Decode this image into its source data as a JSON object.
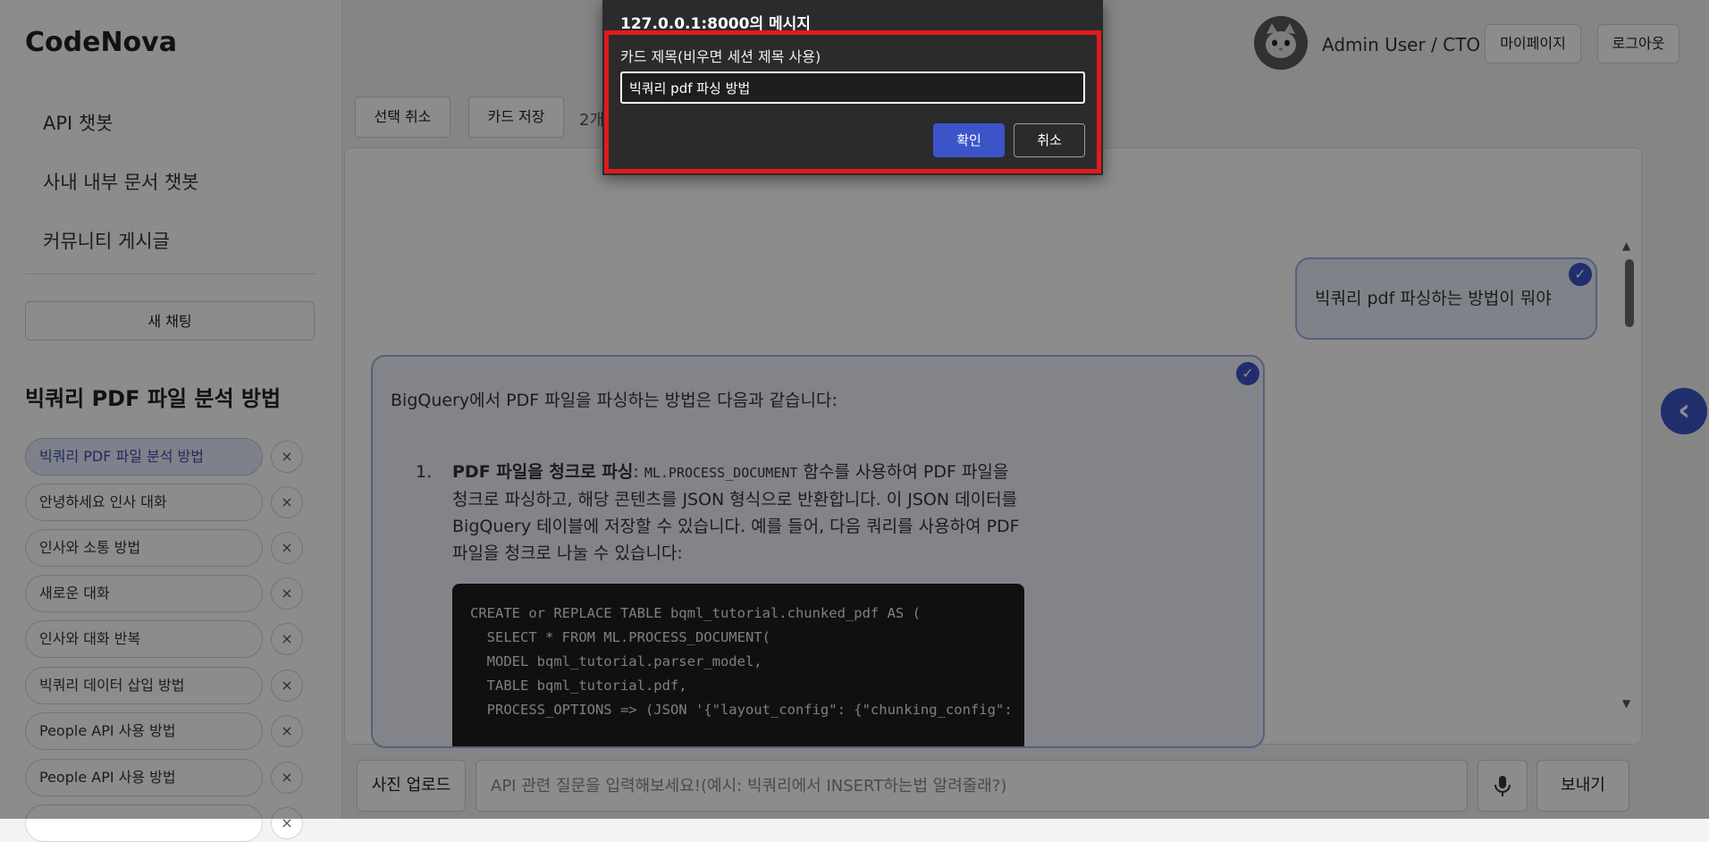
{
  "sidebar": {
    "logo": "CodeNova",
    "nav": [
      "API 챗봇",
      "사내 내부 문서 챗봇",
      "커뮤니티 게시글"
    ],
    "new_chat": "새 채팅",
    "session_title": "빅쿼리 PDF 파일 분석 방법",
    "sessions": [
      "빅쿼리 PDF 파일 분석 방법",
      "안녕하세요 인사 대화",
      "인사와 소통 방법",
      "새로운 대화",
      "인사와 대화 반복",
      "빅쿼리 데이터 삽입 방법",
      "People API 사용 방법",
      "People API 사용 방법"
    ],
    "delete_glyph": "×"
  },
  "header": {
    "user": "Admin User / CTO",
    "mypage": "마이페이지",
    "logout": "로그아웃"
  },
  "toolbar": {
    "deselect": "선택 취소",
    "save_card": "카드 저장",
    "selected_count": "2개"
  },
  "chat": {
    "user_message": "빅쿼리 pdf 파싱하는 방법이 뭐야",
    "bot_intro": "BigQuery에서 PDF 파일을 파싱하는 방법은 다음과 같습니다:",
    "list_num": "1.",
    "item_title": "PDF 파일을 청크로 파싱",
    "item_func": "ML.PROCESS_DOCUMENT",
    "item_body_1": ": ",
    "item_body_2": " 함수를 사용하여 PDF 파일을 청크로 파싱하고, 해당 콘텐츠를 JSON 형식으로 반환합니다. 이 JSON 데이터를 BigQuery 테이블에 저장할 수 있습니다. 예를 들어, 다음 쿼리를 사용하여 PDF 파일을 청크로 나눌 수 있습니다:",
    "code": "CREATE or REPLACE TABLE bqml_tutorial.chunked_pdf AS (\n  SELECT * FROM ML.PROCESS_DOCUMENT(\n  MODEL bqml_tutorial.parser_model,\n  TABLE bqml_tutorial.pdf,\n  PROCESS_OPTIONS => (JSON '{\"layout_config\": {\"chunking_config\":",
    "check_glyph": "✓"
  },
  "bottom": {
    "upload": "사진 업로드",
    "placeholder": "API 관련 질문을 입력해보세요!(예시: 빅쿼리에서 INSERT하는법 알려줄래?)",
    "mic_icon": "microphone-icon",
    "send": "보내기"
  },
  "dialog": {
    "origin": "127.0.0.1:8000의 메시지",
    "label": "카드 제목(비우면 세션 제목 사용)",
    "input_value": "빅쿼리 pdf 파싱 방법",
    "ok": "확인",
    "cancel": "취소"
  },
  "colors": {
    "accent": "#3b55c9",
    "highlight": "#e11b1b",
    "dialog_bg": "#2b2b2b"
  }
}
